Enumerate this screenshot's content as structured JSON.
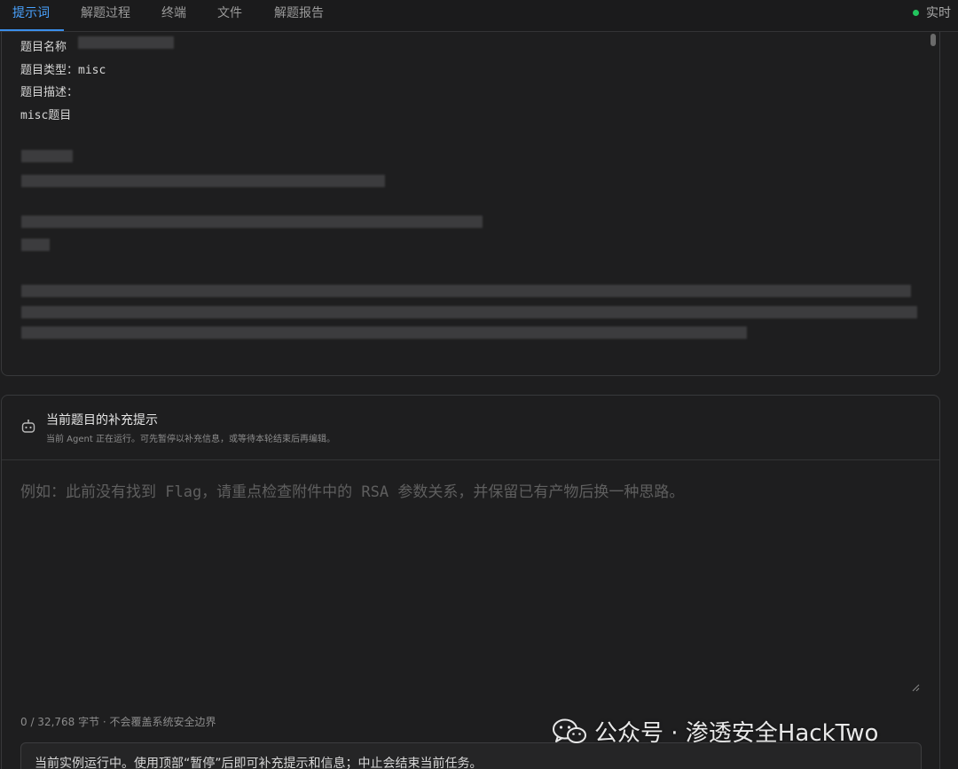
{
  "tabs": [
    {
      "label": "提示词",
      "active": true
    },
    {
      "label": "解题过程",
      "active": false
    },
    {
      "label": "终端",
      "active": false
    },
    {
      "label": "文件",
      "active": false
    },
    {
      "label": "解题报告",
      "active": false
    }
  ],
  "status": {
    "label": "实时",
    "color": "#22c55e"
  },
  "prompt": {
    "lines": [
      "题目名称",
      "题目类型：misc",
      "题目描述：",
      "misc题目"
    ]
  },
  "supplement": {
    "title": "当前题目的补充提示",
    "subtitle": "当前 Agent 正在运行。可先暂停以补充信息，或等待本轮结束后再编辑。",
    "placeholder": "例如：此前没有找到 Flag，请重点检查附件中的 RSA 参数关系，并保留已有产物后换一种思路。",
    "counter": "0 / 32,768 字节 · 不会覆盖系统安全边界",
    "notice": "当前实例运行中。使用顶部“暂停”后即可补充提示和信息；中止会结束当前任务。"
  },
  "watermark": {
    "text": "公众号 · 渗透安全HackTwo"
  },
  "colors": {
    "accent": "#3b8eea",
    "background": "#1e1e1f"
  }
}
